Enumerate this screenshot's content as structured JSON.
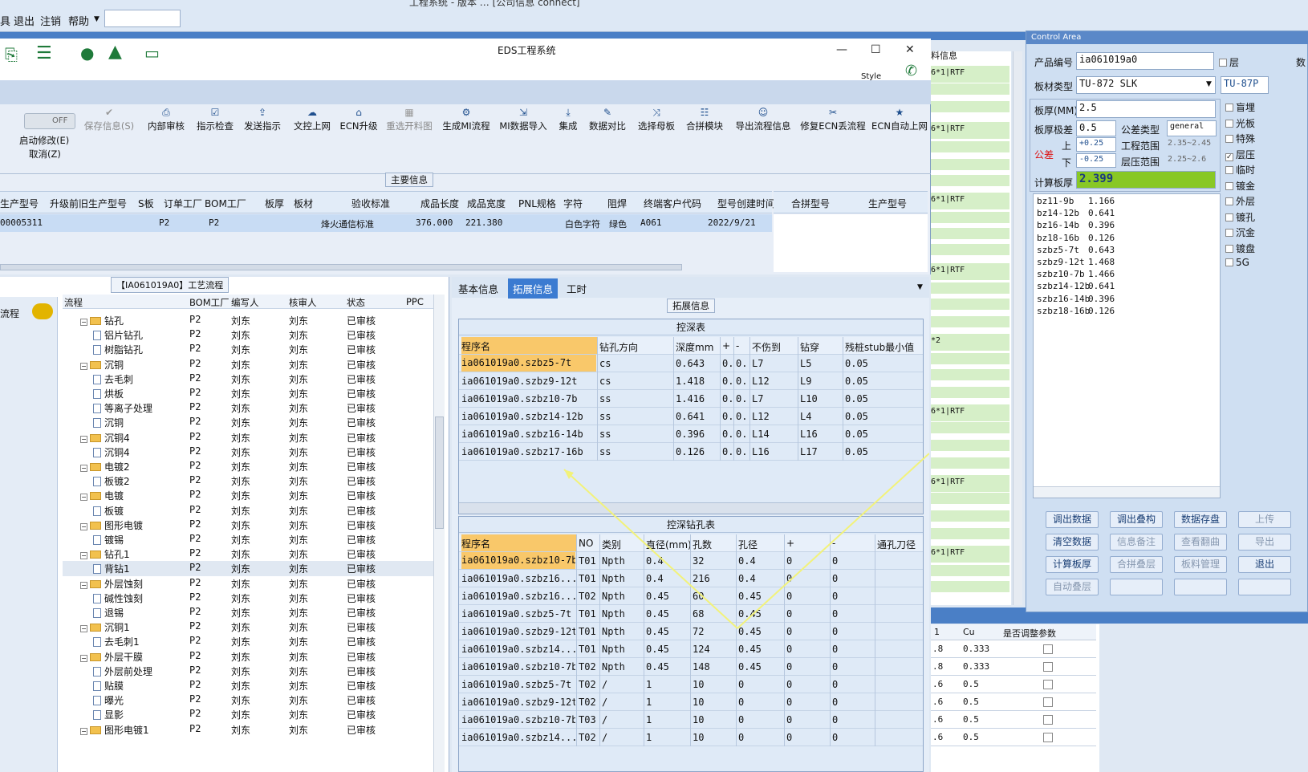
{
  "topmenu": {
    "title": "工程系统 - 版本 … [公司信息 connect]",
    "items": [
      "退出",
      "注销",
      "帮助"
    ]
  },
  "eds": {
    "title": "EDS工程系统",
    "style_label": "Style",
    "off_label": "OFF",
    "left_btns": [
      "启动修改(E)",
      "取消(Z)"
    ],
    "toolbar": [
      "保存信息(S)",
      "内部审核",
      "指示检查",
      "发送指示",
      "文控上网",
      "ECN升级",
      "重选开料图",
      "生成MI流程",
      "MI数据导入",
      "集成",
      "数据对比",
      "选择母板",
      "合拼模块",
      "导出流程信息",
      "修复ECN丢流程",
      "ECN自动上网"
    ],
    "section_label": "主要信息",
    "columns": [
      "生产型号",
      "升级前旧生产型号",
      "S板",
      "订单工厂",
      "BOM工厂",
      "板厚",
      "板材",
      "验收标准",
      "成品长度",
      "成品宽度",
      "PNL规格",
      "字符",
      "阻焊",
      "终端客户代码",
      "型号创建时间"
    ],
    "row": [
      "00005311",
      "",
      "",
      "P2",
      "P2",
      "",
      "",
      "烽火通信标准",
      "376.000",
      "221.380",
      "",
      "白色字符",
      "绿色",
      "A061",
      "2022/9/21"
    ],
    "right_columns": [
      "合拼型号",
      "生产型号"
    ]
  },
  "tree": {
    "title": "【IA061019A0】工艺流程",
    "nav_label": "流程",
    "columns": [
      "流程",
      "BOM工厂",
      "编写人",
      "核审人",
      "状态",
      "PPC"
    ],
    "rows": [
      {
        "name": "钻孔",
        "lvl": 0,
        "type": "folder"
      },
      {
        "name": "铝片钻孔",
        "lvl": 1,
        "type": "file"
      },
      {
        "name": "树脂钻孔",
        "lvl": 1,
        "type": "file"
      },
      {
        "name": "沉铜",
        "lvl": 0,
        "type": "folder"
      },
      {
        "name": "去毛刺",
        "lvl": 1,
        "type": "file"
      },
      {
        "name": "烘板",
        "lvl": 1,
        "type": "file"
      },
      {
        "name": "等离子处理",
        "lvl": 1,
        "type": "file"
      },
      {
        "name": "沉铜",
        "lvl": 1,
        "type": "file"
      },
      {
        "name": "沉铜4",
        "lvl": 0,
        "type": "folder"
      },
      {
        "name": "沉铜4",
        "lvl": 1,
        "type": "file"
      },
      {
        "name": "电镀2",
        "lvl": 0,
        "type": "folder"
      },
      {
        "name": "板镀2",
        "lvl": 1,
        "type": "file"
      },
      {
        "name": "电镀",
        "lvl": 0,
        "type": "folder"
      },
      {
        "name": "板镀",
        "lvl": 1,
        "type": "file"
      },
      {
        "name": "图形电镀",
        "lvl": 0,
        "type": "folder"
      },
      {
        "name": "镀锡",
        "lvl": 1,
        "type": "file"
      },
      {
        "name": "钻孔1",
        "lvl": 0,
        "type": "folder"
      },
      {
        "name": "背钻1",
        "lvl": 1,
        "type": "file",
        "sel": true
      },
      {
        "name": "外层蚀刻",
        "lvl": 0,
        "type": "folder"
      },
      {
        "name": "碱性蚀刻",
        "lvl": 1,
        "type": "file"
      },
      {
        "name": "退锡",
        "lvl": 1,
        "type": "file"
      },
      {
        "name": "沉铜1",
        "lvl": 0,
        "type": "folder"
      },
      {
        "name": "去毛刺1",
        "lvl": 1,
        "type": "file"
      },
      {
        "name": "外层干膜",
        "lvl": 0,
        "type": "folder"
      },
      {
        "name": "外层前处理",
        "lvl": 1,
        "type": "file"
      },
      {
        "name": "贴膜",
        "lvl": 1,
        "type": "file"
      },
      {
        "name": "曝光",
        "lvl": 1,
        "type": "file"
      },
      {
        "name": "显影",
        "lvl": 1,
        "type": "file"
      },
      {
        "name": "图形电镀1",
        "lvl": 0,
        "type": "folder"
      }
    ],
    "factory": "P2",
    "writer": "刘东",
    "reviewer": "刘东",
    "status": "已审核"
  },
  "mid": {
    "tabs": [
      "基本信息",
      "拓展信息",
      "工时"
    ],
    "section": "拓展信息",
    "t1": {
      "caption": "控深表",
      "columns": [
        "程序名",
        "钻孔方向",
        "深度mm",
        "+",
        "-",
        "不伤到",
        "钻穿",
        "残桩stub最小值"
      ],
      "rows": [
        [
          "ia061019a0.szbz5-7t",
          "cs",
          "0.643",
          "0..",
          "0..",
          "L7",
          "L5",
          "0.05"
        ],
        [
          "ia061019a0.szbz9-12t",
          "cs",
          "1.418",
          "0..",
          "0..",
          "L12",
          "L9",
          "0.05"
        ],
        [
          "ia061019a0.szbz10-7b",
          "ss",
          "1.416",
          "0..",
          "0..",
          "L7",
          "L10",
          "0.05"
        ],
        [
          "ia061019a0.szbz14-12b",
          "ss",
          "0.641",
          "0..",
          "0..",
          "L12",
          "L4",
          "0.05"
        ],
        [
          "ia061019a0.szbz16-14b",
          "ss",
          "0.396",
          "0..",
          "0..",
          "L14",
          "L16",
          "0.05"
        ],
        [
          "ia061019a0.szbz17-16b",
          "ss",
          "0.126",
          "0..",
          "0..",
          "L16",
          "L17",
          "0.05"
        ]
      ]
    },
    "t2": {
      "caption": "控深钻孔表",
      "columns": [
        "程序名",
        "NO",
        "类别",
        "直径(mm)",
        "孔数",
        "孔径",
        "+",
        "-",
        "通孔刀径"
      ],
      "rows": [
        [
          "ia061019a0.szbz10-7b",
          "T01",
          "Npth",
          "0.4",
          "32",
          "0.4",
          "0",
          "0"
        ],
        [
          "ia061019a0.szbz16...",
          "T01",
          "Npth",
          "0.4",
          "216",
          "0.4",
          "0",
          "0"
        ],
        [
          "ia061019a0.szbz16...",
          "T02",
          "Npth",
          "0.45",
          "60",
          "0.45",
          "0",
          "0"
        ],
        [
          "ia061019a0.szbz5-7t",
          "T01",
          "Npth",
          "0.45",
          "68",
          "0.45",
          "0",
          "0"
        ],
        [
          "ia061019a0.szbz9-12t",
          "T01",
          "Npth",
          "0.45",
          "72",
          "0.45",
          "0",
          "0"
        ],
        [
          "ia061019a0.szbz14...",
          "T01",
          "Npth",
          "0.45",
          "124",
          "0.45",
          "0",
          "0"
        ],
        [
          "ia061019a0.szbz10-7b",
          "T02",
          "Npth",
          "0.45",
          "148",
          "0.45",
          "0",
          "0"
        ],
        [
          "ia061019a0.szbz5-7t",
          "T02",
          "/",
          "1",
          "10",
          "0",
          "0",
          "0"
        ],
        [
          "ia061019a0.szbz9-12t",
          "T02",
          "/",
          "1",
          "10",
          "0",
          "0",
          "0"
        ],
        [
          "ia061019a0.szbz10-7b",
          "T03",
          "/",
          "1",
          "10",
          "0",
          "0",
          "0"
        ],
        [
          "ia061019a0.szbz14...",
          "T02",
          "/",
          "1",
          "10",
          "0",
          "0",
          "0"
        ]
      ]
    }
  },
  "stripes": [
    "6*1|RTF",
    "6*1|RTF",
    "6*1|RTF",
    "6*1|RTF",
    "*2",
    "6*1|RTF",
    "6*1|RTF",
    "6*1|RTF"
  ],
  "ctrl": {
    "title": "Control Area",
    "product_label": "产品编号",
    "product": "ia061019a0",
    "board_label": "板材类型",
    "board": "TU-872 SLK",
    "board2": "TU-87P",
    "thick_label": "板厚(MM)",
    "thick": "2.5",
    "pole_label": "板厚极差",
    "pole": "0.5",
    "tol_type_label": "公差类型",
    "tol_type": "general",
    "tol_label": "公差",
    "up": "上",
    "down": "下",
    "up_val": "+0.25",
    "down_val": "-0.25",
    "eng_range_label": "工程范围",
    "eng_range": "2.35~2.45",
    "layer_range_label": "层压范围",
    "layer_range": "2.25~2.6",
    "calc_label": "计算板厚",
    "calc": "2.399",
    "layer_chk": "层",
    "shu": "数",
    "list": [
      [
        "bz11-9b",
        "1.166"
      ],
      [
        "bz14-12b",
        "0.641"
      ],
      [
        "bz16-14b",
        "0.396"
      ],
      [
        "bz18-16b",
        "0.126"
      ],
      [
        "szbz5-7t",
        "0.643"
      ],
      [
        "szbz9-12t",
        "1.468"
      ],
      [
        "szbz10-7b",
        "1.466"
      ],
      [
        "szbz14-12b",
        "0.641"
      ],
      [
        "szbz16-14b",
        "0.396"
      ],
      [
        "szbz18-16b",
        "0.126"
      ]
    ],
    "checks": [
      "盲埋",
      "光板",
      "特殊",
      "层压",
      "临时",
      "镀金",
      "外层",
      "镀孔",
      "沉金",
      "镀盘",
      "5G"
    ],
    "buttons": [
      [
        "调出数据",
        "调出叠构",
        "数据存盘",
        "上传"
      ],
      [
        "清空数据",
        "信息备注",
        "查看翻曲",
        "导出"
      ],
      [
        "计算板厚",
        "合拼叠层",
        "板料管理",
        "退出"
      ],
      [
        "自动叠层",
        "",
        "",
        ""
      ]
    ]
  },
  "bottom": {
    "header": [
      "1",
      "Cu",
      "是否调整参数"
    ],
    "rows": [
      [
        ".8",
        "0.333"
      ],
      [
        ".8",
        "0.333"
      ],
      [
        ".6",
        "0.5"
      ],
      [
        ".6",
        "0.5"
      ],
      [
        ".6",
        "0.5"
      ],
      [
        ".6",
        "0.5"
      ]
    ]
  },
  "colors": {
    "accent": "#3b7bd1",
    "highlight": "#f9c86a",
    "green": "#d6efc8"
  }
}
